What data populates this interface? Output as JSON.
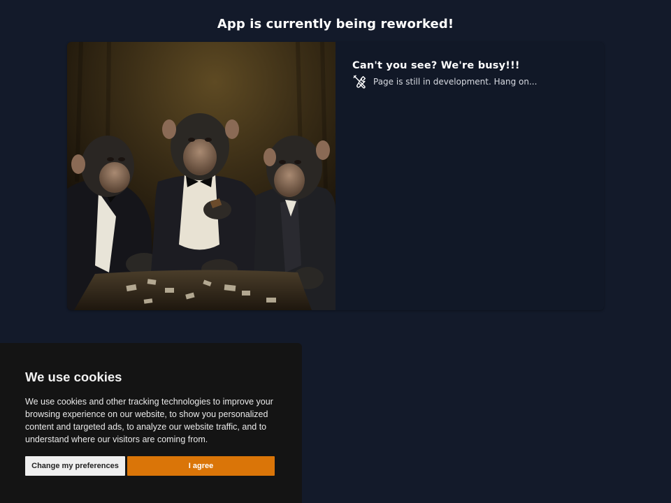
{
  "header": {
    "title": "App is currently being reworked!"
  },
  "card": {
    "image_alt": "Chimpanzees in suits playing cards",
    "title": "Can't you see? We're busy!!!",
    "status_icon": "tools-icon",
    "status_text": "Page is still in development. Hang on..."
  },
  "cookie_banner": {
    "title": "We use cookies",
    "text": "We use cookies and other tracking technologies to improve your browsing experience on our website, to show you personalized content and targeted ads, to analyze our website traffic, and to understand where our visitors are coming from.",
    "preferences_label": "Change my preferences",
    "agree_label": "I agree"
  },
  "colors": {
    "page_background": "#131a2a",
    "card_background": "#111827",
    "banner_background": "#141414",
    "accent": "#da7508"
  }
}
